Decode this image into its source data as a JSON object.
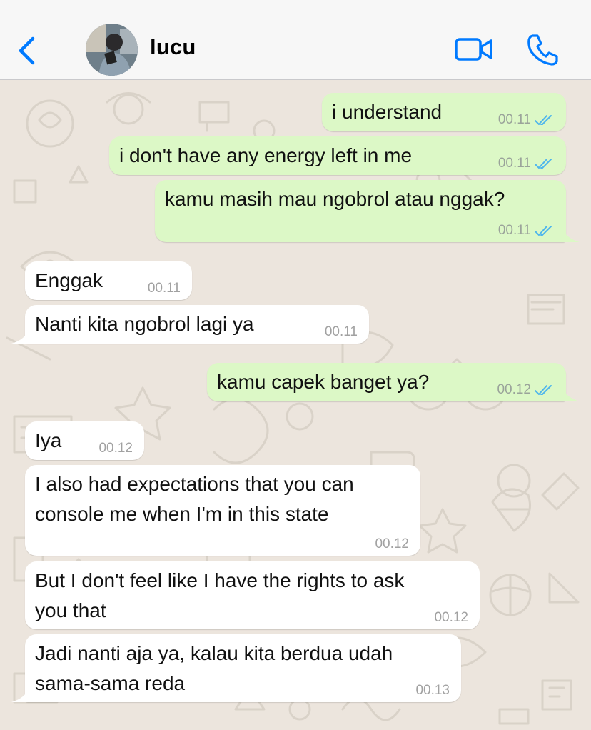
{
  "header": {
    "contact_name": "lucu"
  },
  "messages": [
    {
      "text": "i understand",
      "time": "00.11",
      "dir": "out"
    },
    {
      "text": "i don't have any energy left in me",
      "time": "00.11",
      "dir": "out"
    },
    {
      "text": "kamu masih mau ngobrol atau nggak?",
      "time": "00.11",
      "dir": "out"
    },
    {
      "text": "Enggak",
      "time": "00.11",
      "dir": "in"
    },
    {
      "text": "Nanti kita ngobrol lagi ya",
      "time": "00.11",
      "dir": "in"
    },
    {
      "text": "kamu capek banget ya?",
      "time": "00.12",
      "dir": "out"
    },
    {
      "text": "Iya",
      "time": "00.12",
      "dir": "in"
    },
    {
      "text_line1": "I also had expectations that you can",
      "text_line2": "console me when I'm in this state",
      "time": "00.12",
      "dir": "in"
    },
    {
      "text_line1": "But I don't feel like I have the rights to ask",
      "text_line2": "you that",
      "time": "00.12",
      "dir": "in"
    },
    {
      "text_line1": "Jadi nanti aja ya, kalau kita berdua udah",
      "text_line2": "sama-sama reda",
      "time": "00.13",
      "dir": "in"
    }
  ],
  "colors": {
    "accent": "#007aff",
    "outgoing": "#dcf8c6",
    "incoming": "#ffffff",
    "read_ticks": "#4fb6ec"
  }
}
